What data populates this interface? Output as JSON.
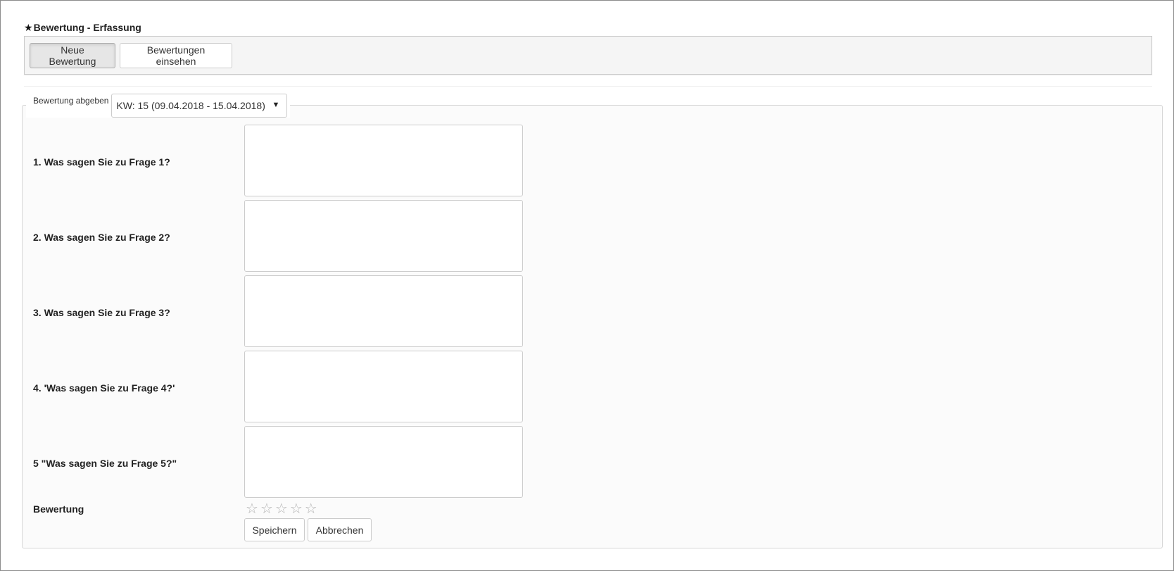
{
  "header": {
    "title": "Bewertung - Erfassung",
    "title_icon": "star-icon"
  },
  "toolbar": {
    "new_label": "Neue Bewertung",
    "view_label": "Bewertungen einsehen"
  },
  "form": {
    "legend": "Bewertung abgeben",
    "week_selected": "KW: 15 (09.04.2018 - 15.04.2018)",
    "questions": [
      {
        "label": "1. Was sagen Sie zu Frage 1?",
        "value": ""
      },
      {
        "label": "2. Was sagen Sie zu Frage 2?",
        "value": ""
      },
      {
        "label": "3. Was sagen Sie zu Frage 3?",
        "value": ""
      },
      {
        "label": "4. 'Was sagen Sie zu Frage 4?'",
        "value": ""
      },
      {
        "label": "5 \"Was sagen Sie zu Frage 5?\"",
        "value": ""
      }
    ],
    "rating_label": "Bewertung",
    "rating_value": 0,
    "rating_max": 5,
    "save_label": "Speichern",
    "cancel_label": "Abbrechen"
  }
}
